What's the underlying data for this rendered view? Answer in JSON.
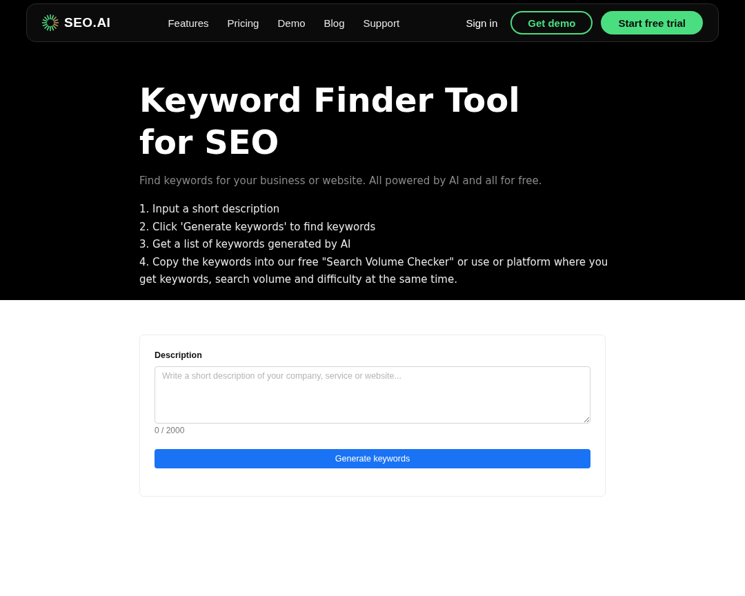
{
  "header": {
    "logo": "SEO.AI",
    "nav": [
      "Features",
      "Pricing",
      "Demo",
      "Blog",
      "Support"
    ],
    "sign_in": "Sign in",
    "buttons": [
      {
        "label": "Get demo",
        "kind": "outline"
      },
      {
        "label": "Start free trial",
        "kind": "filled"
      }
    ]
  },
  "hero": {
    "title": "Keyword Finder Tool for SEO",
    "subtitle": "Find keywords for your business or website. All powered by AI and all for free.",
    "steps": [
      "1. Input a short description",
      "2. Click 'Generate keywords' to find keywords",
      "3. Get a list of keywords generated by AI",
      "4. Copy the keywords into our free \"Search Volume Checker\" or use or platform where you get keywords, search volume and difficulty at the same time."
    ]
  },
  "form": {
    "label": "Description",
    "placeholder": "Write a short description of your company, service or website...",
    "counter": "0 / 2000",
    "button": "Generate keywords"
  }
}
